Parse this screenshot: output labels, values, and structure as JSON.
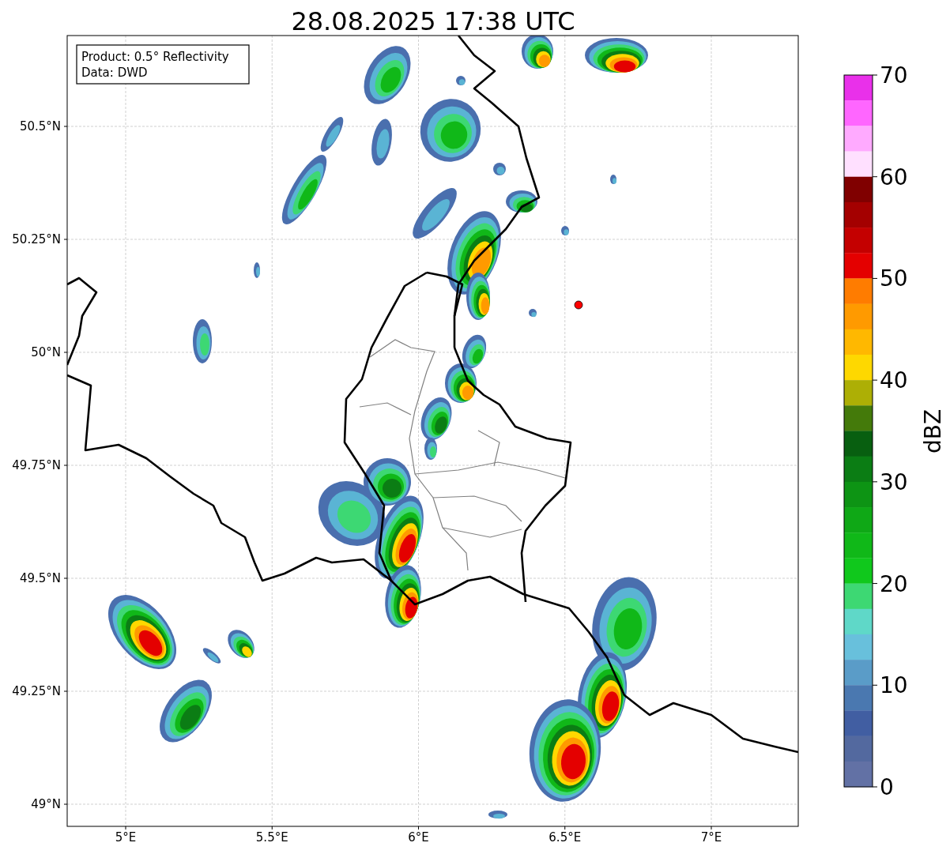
{
  "title": "28.08.2025 17:38 UTC",
  "info_box": {
    "lines": [
      "Product: 0.5° Reflectivity",
      "Data: DWD"
    ]
  },
  "map": {
    "xticks": [
      "5°E",
      "5.5°E",
      "6°E",
      "6.5°E",
      "7°E"
    ],
    "yticks": [
      "50.5°N",
      "50.25°N",
      "50°N",
      "49.75°N",
      "49.5°N",
      "49.25°N",
      "49°N"
    ]
  },
  "colorbar": {
    "label": "dBZ",
    "ticks": [
      "70",
      "60",
      "50",
      "40",
      "30",
      "20",
      "10",
      "0"
    ],
    "bands": [
      {
        "color": "#e930ea"
      },
      {
        "color": "#ff66ff"
      },
      {
        "color": "#ffaaff"
      },
      {
        "color": "#ffe0ff"
      },
      {
        "color": "#800000"
      },
      {
        "color": "#a40000"
      },
      {
        "color": "#c40000"
      },
      {
        "color": "#e40000"
      },
      {
        "color": "#ff7c00"
      },
      {
        "color": "#ff9a00"
      },
      {
        "color": "#ffb800"
      },
      {
        "color": "#fed800"
      },
      {
        "color": "#adaf05"
      },
      {
        "color": "#447a0a"
      },
      {
        "color": "#085f10"
      },
      {
        "color": "#0b7d14"
      },
      {
        "color": "#0d9414"
      },
      {
        "color": "#0fa816"
      },
      {
        "color": "#10b818"
      },
      {
        "color": "#10c81c"
      },
      {
        "color": "#3dd873"
      },
      {
        "color": "#5fd8c8"
      },
      {
        "color": "#68c0dc"
      },
      {
        "color": "#5a9cc8"
      },
      {
        "color": "#4a78b0"
      },
      {
        "color": "#415ea2"
      },
      {
        "color": "#53699f"
      },
      {
        "color": "#6271a5"
      }
    ]
  }
}
